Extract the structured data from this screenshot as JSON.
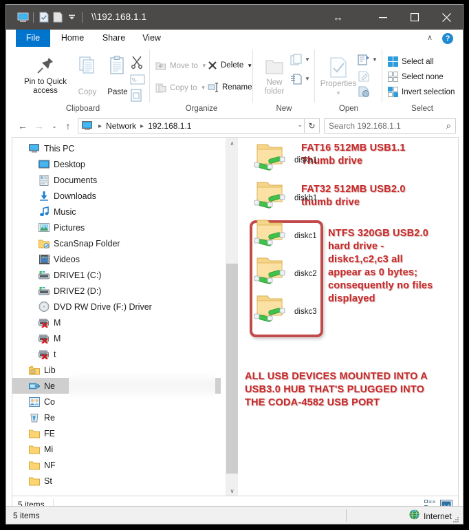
{
  "window": {
    "title": "\\\\192.168.1.1",
    "quick_access": [
      "computer-icon",
      "properties-icon",
      "new-folder-icon",
      "qat-dropdown-icon"
    ],
    "caption": {
      "minimize": "─",
      "maximize": "☐",
      "close": "✕",
      "resize_cursor": "↔"
    }
  },
  "ribbon": {
    "tabs": [
      {
        "label": "File",
        "active": false,
        "is_file": true
      },
      {
        "label": "Home",
        "active": true
      },
      {
        "label": "Share",
        "active": false
      },
      {
        "label": "View",
        "active": false
      }
    ],
    "collapse_label": "∧",
    "help_label": "?",
    "groups": [
      {
        "name": "Clipboard",
        "big": [
          {
            "label": "Pin to Quick\naccess",
            "line1": "Pin to Quick",
            "line2": "access",
            "dim": false
          },
          {
            "label": "Copy",
            "dim": true
          },
          {
            "label": "Paste",
            "dim": false
          }
        ],
        "small": [
          "Cut",
          "Copy path",
          "Paste shortcut"
        ]
      },
      {
        "name": "Organize",
        "small": [
          {
            "label": "Move to",
            "dim": true,
            "dropdown": true
          },
          {
            "label": "Copy to",
            "dim": true,
            "dropdown": true
          },
          {
            "label": "Delete",
            "dim": false,
            "dropdown": true
          },
          {
            "label": "Rename",
            "dim": false,
            "dropdown": false
          }
        ]
      },
      {
        "name": "New",
        "big": [
          {
            "line1": "New",
            "line2": "folder",
            "dim": true
          }
        ],
        "small": [
          "New item",
          "Easy access"
        ]
      },
      {
        "name": "Open",
        "big": [
          {
            "line1": "Properties",
            "line2": "",
            "dim": true
          }
        ],
        "small": [
          "Open",
          "Edit",
          "History"
        ]
      },
      {
        "name": "Select",
        "small": [
          {
            "label": "Select all",
            "dim": false
          },
          {
            "label": "Select none",
            "dim": false
          },
          {
            "label": "Invert selection",
            "dim": false
          }
        ]
      }
    ]
  },
  "address": {
    "back": "←",
    "forward": "→",
    "recent": "⌄",
    "up": "↑",
    "crumbs": [
      "Network",
      "192.168.1.1"
    ],
    "dropdown": "⌄",
    "refresh": "↻",
    "search_placeholder": "Search 192.168.1.1",
    "search_icon": "⌕"
  },
  "navpane": {
    "items": [
      {
        "label": "This PC",
        "icon": "computer-icon",
        "indent": 24,
        "selected": false
      },
      {
        "label": "Desktop",
        "icon": "desktop-icon",
        "indent": 38,
        "selected": false
      },
      {
        "label": "Documents",
        "icon": "documents-icon",
        "indent": 38,
        "selected": false
      },
      {
        "label": "Downloads",
        "icon": "downloads-icon",
        "indent": 38,
        "selected": false
      },
      {
        "label": "Music",
        "icon": "music-icon",
        "indent": 38,
        "selected": false
      },
      {
        "label": "Pictures",
        "icon": "pictures-icon",
        "indent": 38,
        "selected": false
      },
      {
        "label": "ScanSnap Folder",
        "icon": "scansnap-folder-icon",
        "indent": 38,
        "selected": false
      },
      {
        "label": "Videos",
        "icon": "videos-icon",
        "indent": 38,
        "selected": false
      },
      {
        "label": "DRIVE1 (C:)",
        "icon": "local-disk-icon",
        "indent": 38,
        "selected": false
      },
      {
        "label": "DRIVE2 (D:)",
        "icon": "local-disk-icon",
        "indent": 38,
        "selected": false
      },
      {
        "label": "DVD RW Drive (F:) Driver",
        "icon": "dvd-drive-icon",
        "indent": 38,
        "selected": false
      },
      {
        "label": "M",
        "icon": "disconnected-network-drive-icon",
        "indent": 38,
        "selected": false
      },
      {
        "label": "M",
        "icon": "disconnected-network-drive-icon",
        "indent": 38,
        "selected": false
      },
      {
        "label": "t",
        "icon": "disconnected-network-drive-icon",
        "indent": 38,
        "selected": false
      },
      {
        "label": "Lib",
        "icon": "libraries-icon",
        "indent": 24,
        "selected": false
      },
      {
        "label": "Ne",
        "icon": "network-icon",
        "indent": 24,
        "selected": true
      },
      {
        "label": "Co",
        "icon": "homegroup-icon",
        "indent": 24,
        "selected": false
      },
      {
        "label": "Re",
        "icon": "recycle-bin-icon",
        "indent": 24,
        "selected": false
      },
      {
        "label": "FE",
        "icon": "folder-icon",
        "indent": 24,
        "selected": false
      },
      {
        "label": "Mi",
        "icon": "folder-icon",
        "indent": 24,
        "selected": false
      },
      {
        "label": "NF",
        "icon": "folder-icon",
        "indent": 24,
        "selected": false
      },
      {
        "label": "St",
        "icon": "folder-icon",
        "indent": 24,
        "selected": false
      }
    ],
    "scroll_up": "∧",
    "scroll_down": "∨"
  },
  "filepane": {
    "shares": [
      {
        "name": "diska1",
        "icon": "network-share-folder-icon"
      },
      {
        "name": "diskb1",
        "icon": "network-share-folder-icon"
      },
      {
        "name": "diskc1",
        "icon": "network-share-folder-icon"
      },
      {
        "name": "diskc2",
        "icon": "network-share-folder-icon"
      },
      {
        "name": "diskc3",
        "icon": "network-share-folder-icon"
      }
    ]
  },
  "annotations": {
    "color": "#c62a2a",
    "box_color": "#c24a4a",
    "items": [
      {
        "id": "anno-diska1",
        "lines": [
          "FAT16 512MB USB1.1",
          "Thumb drive"
        ]
      },
      {
        "id": "anno-diskb1",
        "lines": [
          "FAT32 512MB USB2.0",
          "thumb drive"
        ]
      },
      {
        "id": "anno-diskc",
        "lines": [
          "NTFS 320GB USB2.0",
          "hard drive -",
          "diskc1,c2,c3 all",
          "appear as 0 bytes;",
          "consequently no files",
          "displayed"
        ]
      },
      {
        "id": "anno-footer",
        "lines": [
          "ALL USB DEVICES MOUNTED INTO A",
          "USB3.0 HUB THAT'S PLUGGED INTO",
          "THE CODA-4582 USB PORT"
        ]
      }
    ]
  },
  "inner_status": {
    "count": "5 items",
    "view_details": "details-view-icon",
    "view_icons": "large-icons-view-icon"
  },
  "outer_status": {
    "count": "5 items",
    "zone": "Internet",
    "zone_icon": "internet-globe-icon"
  }
}
